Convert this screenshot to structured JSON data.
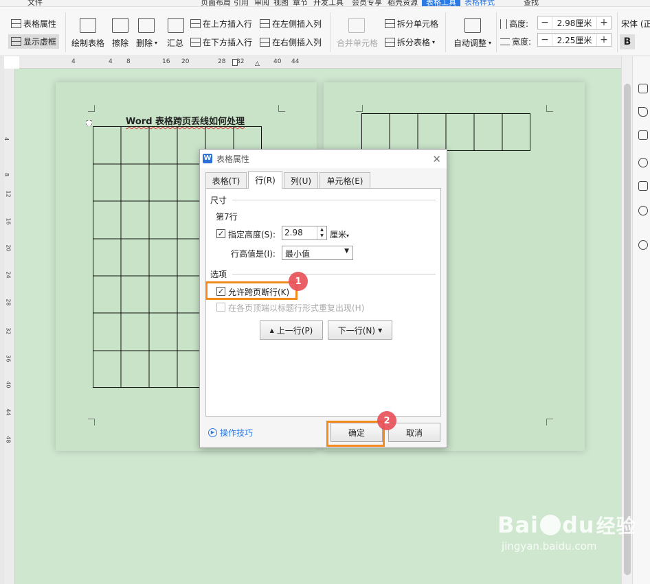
{
  "menu": {
    "items": [
      "文件",
      "页面布局",
      "引用",
      "审阅",
      "视图",
      "章节",
      "开发工具",
      "会员专享",
      "稻壳资源"
    ],
    "active_tab": "表格工具",
    "style_tab": "表格样式",
    "search": "查找"
  },
  "ribbon": {
    "table_props": "表格属性",
    "show_gridlines": "显示虚框",
    "draw_table": "绘制表格",
    "erase": "擦除",
    "delete": "删除",
    "summarize": "汇总",
    "insert_above": "在上方插入行",
    "insert_below": "在下方插入行",
    "insert_left": "在左侧插入列",
    "insert_right": "在右侧插入列",
    "merge_cells": "合并单元格",
    "split_cells": "拆分单元格",
    "split_table": "拆分表格",
    "auto_fit": "自动调整",
    "height_label": "高度:",
    "height_value": "2.98厘米",
    "width_label": "宽度:",
    "width_value": "2.25厘米",
    "font_name": "宋体 (正",
    "bold": "B"
  },
  "ruler_ticks": [
    "4",
    "4",
    "8",
    "16",
    "20",
    "28",
    "32",
    "40",
    "44"
  ],
  "vruler_ticks": [
    "4",
    "8",
    "12",
    "16",
    "20",
    "24",
    "28",
    "32",
    "36",
    "40",
    "44",
    "48"
  ],
  "document": {
    "title": "Word 表格跨页丢线如何处理"
  },
  "dialog": {
    "title": "表格属性",
    "close": "✕",
    "tabs": [
      "表格(T)",
      "行(R)",
      "列(U)",
      "单元格(E)"
    ],
    "section_size": "尺寸",
    "row_label": "第7行",
    "specify_height": "指定高度(S):",
    "height_value": "2.98",
    "unit": "厘米",
    "row_height_is": "行高值是(I):",
    "row_height_mode": "最小值",
    "section_options": "选项",
    "allow_break": "允许跨页断行(K)",
    "repeat_header": "在各页顶端以标题行形式重复出现(H)",
    "prev_row": "上一行(P)",
    "next_row": "下一行(N)",
    "tips": "操作技巧",
    "ok": "确定",
    "cancel": "取消"
  },
  "annotations": {
    "badge1": "1",
    "badge2": "2"
  },
  "watermark": {
    "brand": "Bai",
    "paw": "du",
    "cn": "经验",
    "url": "jingyan.baidu.com"
  },
  "colors": {
    "accent": "#2d7ae5",
    "highlight": "#f28a1e",
    "badge": "#e8535b",
    "page": "#c8e3c8"
  }
}
